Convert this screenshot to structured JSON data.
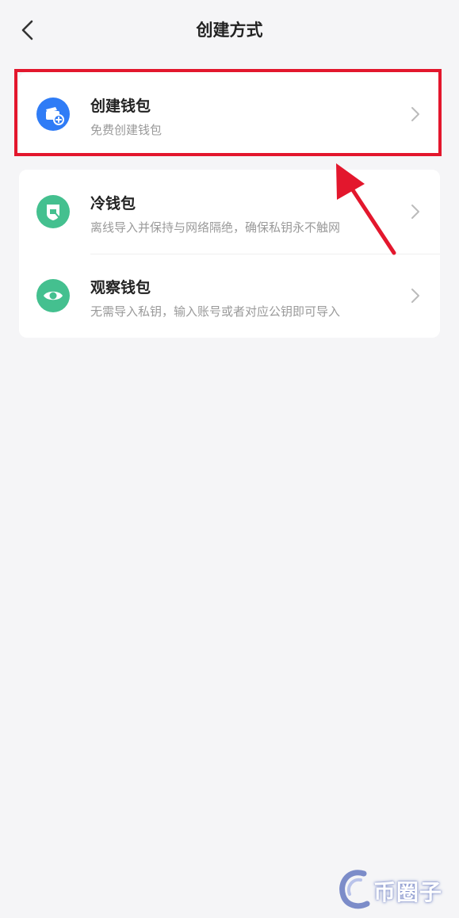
{
  "header": {
    "title": "创建方式"
  },
  "options": [
    {
      "label": "创建钱包",
      "desc": "免费创建钱包",
      "icon": "wallet-add-icon",
      "color": "#2f7cf6"
    },
    {
      "label": "冷钱包",
      "desc": "离线导入并保持与网络隔绝，确保私钥永不触网",
      "icon": "cold-wallet-icon",
      "color": "#44c08f"
    },
    {
      "label": "观察钱包",
      "desc": "无需导入私钥，输入账号或者对应公钥即可导入",
      "icon": "eye-icon",
      "color": "#44c08f"
    }
  ],
  "annotation": {
    "highlight_color": "#e3172d"
  },
  "watermark": {
    "text": "币圈子"
  }
}
